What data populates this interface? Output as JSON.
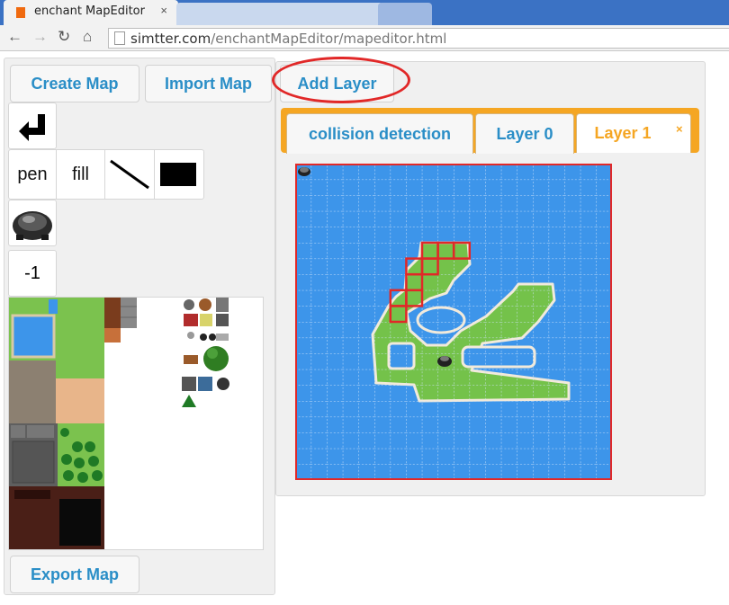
{
  "browser": {
    "tab_title": "enchant MapEditor",
    "tab_close": "×",
    "url_host": "simtter.com",
    "url_path": "/enchantMapEditor/mapeditor.html"
  },
  "buttons": {
    "create_map": "Create Map",
    "import_map": "Import Map",
    "add_layer": "Add Layer",
    "export_map": "Export Map"
  },
  "tools": {
    "pen": "pen",
    "fill": "fill"
  },
  "selected_tile_index": "-1",
  "layer_tabs": [
    {
      "label": "collision detection",
      "active": false
    },
    {
      "label": "Layer 0",
      "active": false
    },
    {
      "label": "Layer 1",
      "active": true
    }
  ],
  "layer_tab_close": "×",
  "colors": {
    "accent_blue": "#2a8ec7",
    "tab_orange": "#f5a623",
    "highlight_red": "#e12828",
    "water": "#3d95ea",
    "grass": "#78c44d"
  }
}
